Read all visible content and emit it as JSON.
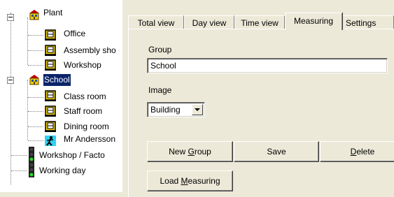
{
  "tree": {
    "items": [
      {
        "label": "Plant",
        "icon": "building-icon"
      },
      {
        "label": "Office",
        "icon": "room-icon"
      },
      {
        "label": "Assembly sho",
        "icon": "room-icon"
      },
      {
        "label": "Workshop",
        "icon": "room-icon"
      },
      {
        "label": "School",
        "icon": "building-icon",
        "selected": true
      },
      {
        "label": "Class room",
        "icon": "room-icon"
      },
      {
        "label": "Staff room",
        "icon": "room-icon"
      },
      {
        "label": "Dining room",
        "icon": "room-icon"
      },
      {
        "label": "Mr Andersson",
        "icon": "person-icon"
      },
      {
        "label": "Workshop / Facto",
        "icon": "traffic-light-icon"
      },
      {
        "label": "Working day",
        "icon": "traffic-light-icon"
      }
    ]
  },
  "tabs": [
    {
      "label": "Total view"
    },
    {
      "label": "Day view"
    },
    {
      "label": "Time view"
    },
    {
      "label": "Measuring",
      "active": true
    },
    {
      "label": "Settings"
    }
  ],
  "form": {
    "group_label": "Group",
    "group_value": "School",
    "image_label": "Image",
    "image_value": "Building",
    "new_group_pre": "New ",
    "new_group_key": "G",
    "new_group_post": "roup",
    "save_label": "Save",
    "delete_key": "D",
    "delete_post": "elete",
    "load_pre": "Load ",
    "load_key": "M",
    "load_post": "easuring"
  },
  "colors": {
    "selection": "#0a246a",
    "window_bg": "#ece9d8"
  }
}
